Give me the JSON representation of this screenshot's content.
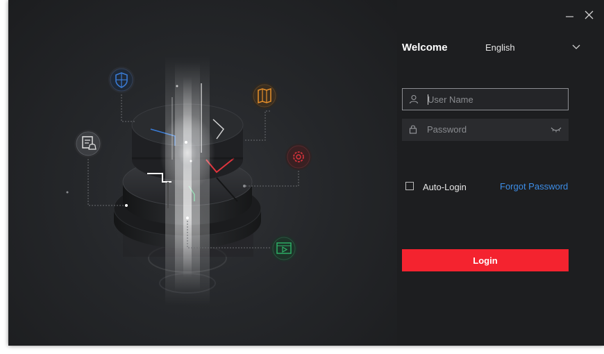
{
  "header": {
    "welcome": "Welcome",
    "language": "English"
  },
  "login": {
    "username_placeholder": "User Name",
    "password_placeholder": "Password",
    "auto_login_label": "Auto-Login",
    "forgot_password": "Forgot Password",
    "login_button": "Login",
    "auto_login_checked": false
  },
  "icons": {
    "top": [
      "minimize-icon",
      "close-icon"
    ],
    "hero": [
      "shield-icon",
      "map-icon",
      "document-bell-icon",
      "gear-icon",
      "video-icon"
    ]
  },
  "colors": {
    "background": "#1e1f21",
    "login_button": "#f4232f",
    "link": "#3d8ee8",
    "shield": "#3a7bd5",
    "map": "#e8902a",
    "gear": "#e0343d",
    "video": "#2fb56a"
  }
}
